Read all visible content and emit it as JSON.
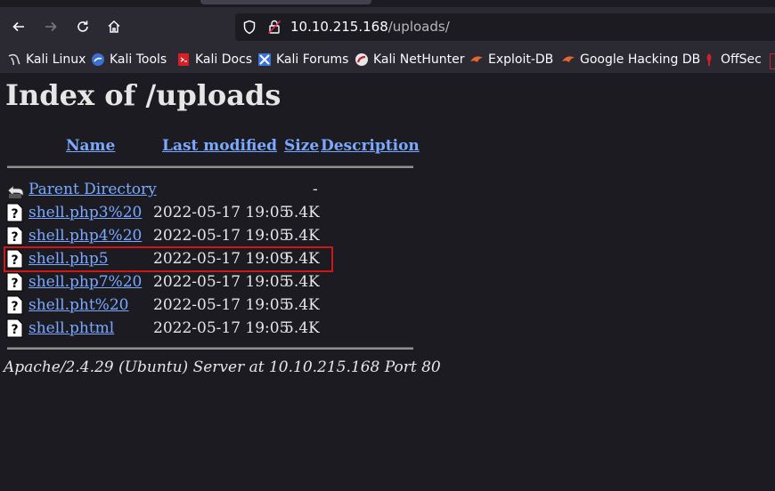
{
  "browser": {
    "url_host": "10.10.215.168",
    "url_path": "/uploads/",
    "accent": "#2b2a33"
  },
  "bookmarks": [
    {
      "label": "Kali Linux",
      "icon": "kali-dragon-icon"
    },
    {
      "label": "Kali Tools",
      "icon": "kali-tools-icon"
    },
    {
      "label": "Kali Docs",
      "icon": "kali-docs-icon"
    },
    {
      "label": "Kali Forums",
      "icon": "kali-forums-icon"
    },
    {
      "label": "Kali NetHunter",
      "icon": "nethunter-icon"
    },
    {
      "label": "Exploit-DB",
      "icon": "exploit-db-icon"
    },
    {
      "label": "Google Hacking DB",
      "icon": "ghdb-icon"
    },
    {
      "label": "OffSec",
      "icon": "offsec-icon"
    }
  ],
  "page": {
    "title": "Index of /uploads",
    "columns": {
      "name": "Name",
      "modified": "Last modified",
      "size": "Size",
      "description": "Description"
    },
    "parent": {
      "name": "Parent Directory",
      "date": "",
      "size": "-"
    },
    "files": [
      {
        "name": "shell.php3%20",
        "date": "2022-05-17 19:05",
        "size": "5.4K"
      },
      {
        "name": "shell.php4%20",
        "date": "2022-05-17 19:05",
        "size": "5.4K"
      },
      {
        "name": "shell.php5",
        "date": "2022-05-17 19:09",
        "size": "5.4K"
      },
      {
        "name": "shell.php7%20",
        "date": "2022-05-17 19:05",
        "size": "5.4K"
      },
      {
        "name": "shell.pht%20",
        "date": "2022-05-17 19:05",
        "size": "5.4K"
      },
      {
        "name": "shell.phtml",
        "date": "2022-05-17 19:05",
        "size": "5.4K"
      }
    ],
    "address": "Apache/2.4.29 (Ubuntu) Server at 10.10.215.168 Port 80",
    "highlight_color": "#d01616",
    "link_color": "#7aa9ff"
  }
}
